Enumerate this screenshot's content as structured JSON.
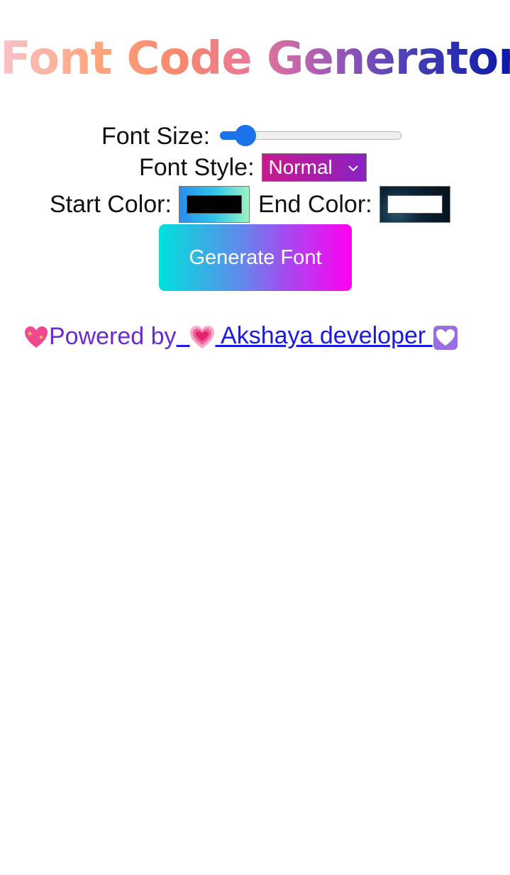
{
  "header": {
    "title": "Font Code Generator"
  },
  "controls": {
    "font_size_label": "Font Size:",
    "font_size_value": 0.14,
    "font_style_label": "Font Style:",
    "font_style_value": "Normal",
    "start_color_label": "Start Color:",
    "start_color_value": "#000000",
    "end_color_label": "End Color:",
    "end_color_value": "#ffffff"
  },
  "generate_button": {
    "label": "Generate Font"
  },
  "footer": {
    "prefix": "Powered by",
    "link_text": " Akshaya developer "
  },
  "icons": {
    "sparkle_heart": "sparkling-heart-icon",
    "growing_heart": "growing-heart-icon",
    "white_heart": "white-heart-icon"
  },
  "colors": {
    "slider_accent": "#1a73e8",
    "footer_prefix": "#6a2ad0",
    "footer_link": "#1a1ae0"
  }
}
